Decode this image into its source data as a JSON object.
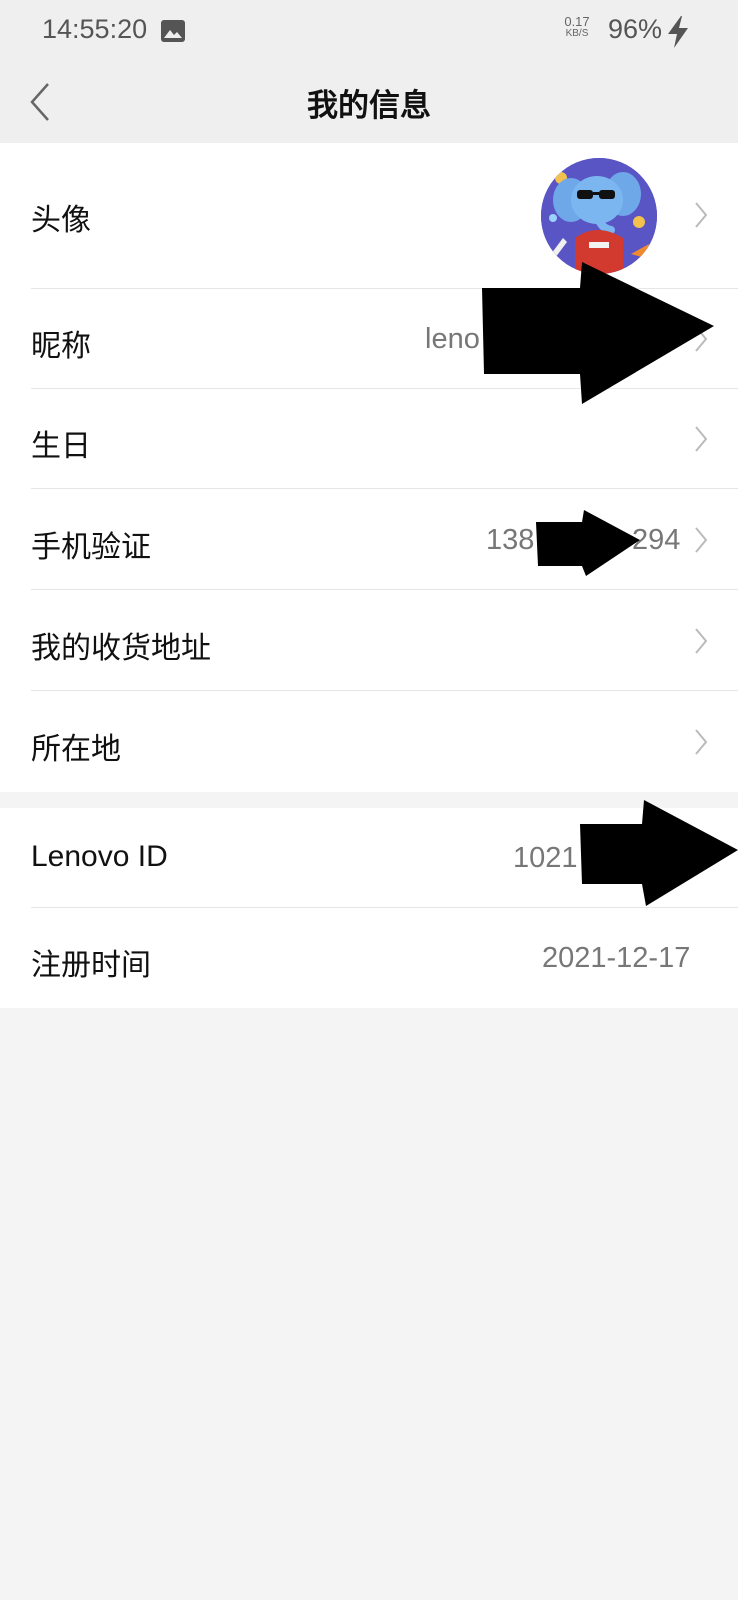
{
  "status_bar": {
    "time": "14:55:20",
    "net_speed_value": "0.17",
    "net_speed_unit": "KB/S",
    "battery": "96%"
  },
  "header": {
    "title": "我的信息"
  },
  "profile": {
    "rows": [
      {
        "label": "头像",
        "value": ""
      },
      {
        "label": "昵称",
        "value": "leno"
      },
      {
        "label": "生日",
        "value": ""
      },
      {
        "label": "手机验证",
        "value_start": "138",
        "value_end": "294"
      },
      {
        "label": "我的收货地址",
        "value": ""
      },
      {
        "label": "所在地",
        "value": ""
      }
    ]
  },
  "account": {
    "rows": [
      {
        "label": "Lenovo ID",
        "value": "1021"
      },
      {
        "label": "注册时间",
        "value": "2021-12-17"
      }
    ]
  },
  "colors": {
    "background": "#f4f4f4",
    "header_background": "#efefef",
    "card": "#ffffff",
    "value_text": "#777777",
    "chevron": "#bbbbbb"
  }
}
